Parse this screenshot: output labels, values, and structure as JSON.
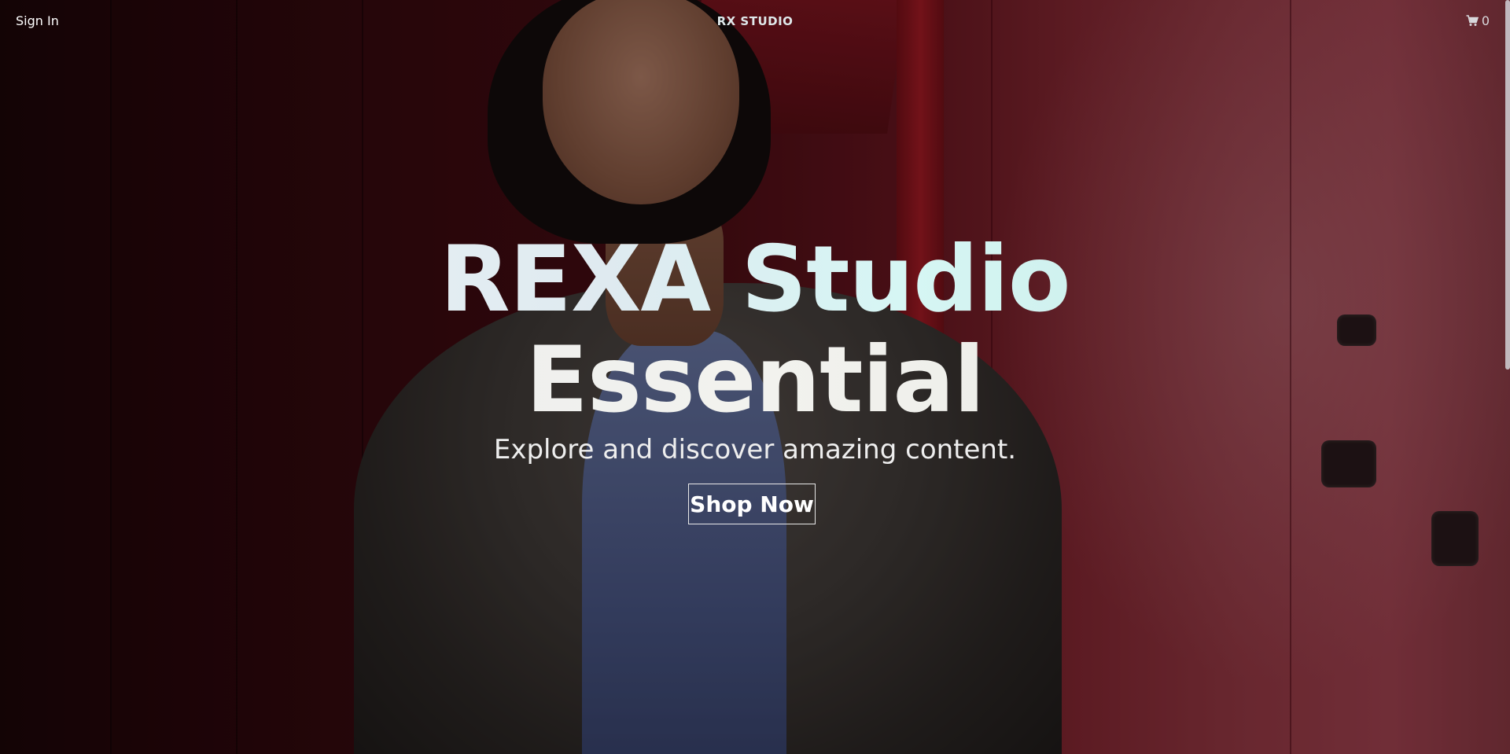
{
  "nav": {
    "sign_in_label": "Sign In",
    "brand": "RX STUDIO",
    "cart_icon": "cart-icon",
    "cart_count": "0"
  },
  "hero": {
    "headline_line1": "REXA Studio",
    "headline_line2": "Essential",
    "subtitle": "Explore and discover amazing content.",
    "cta_label": "Shop Now"
  },
  "colors": {
    "background": "#1a0a0c",
    "text": "#ffffff",
    "brand": "#dfe8ea",
    "accent_red": "#a64452"
  }
}
